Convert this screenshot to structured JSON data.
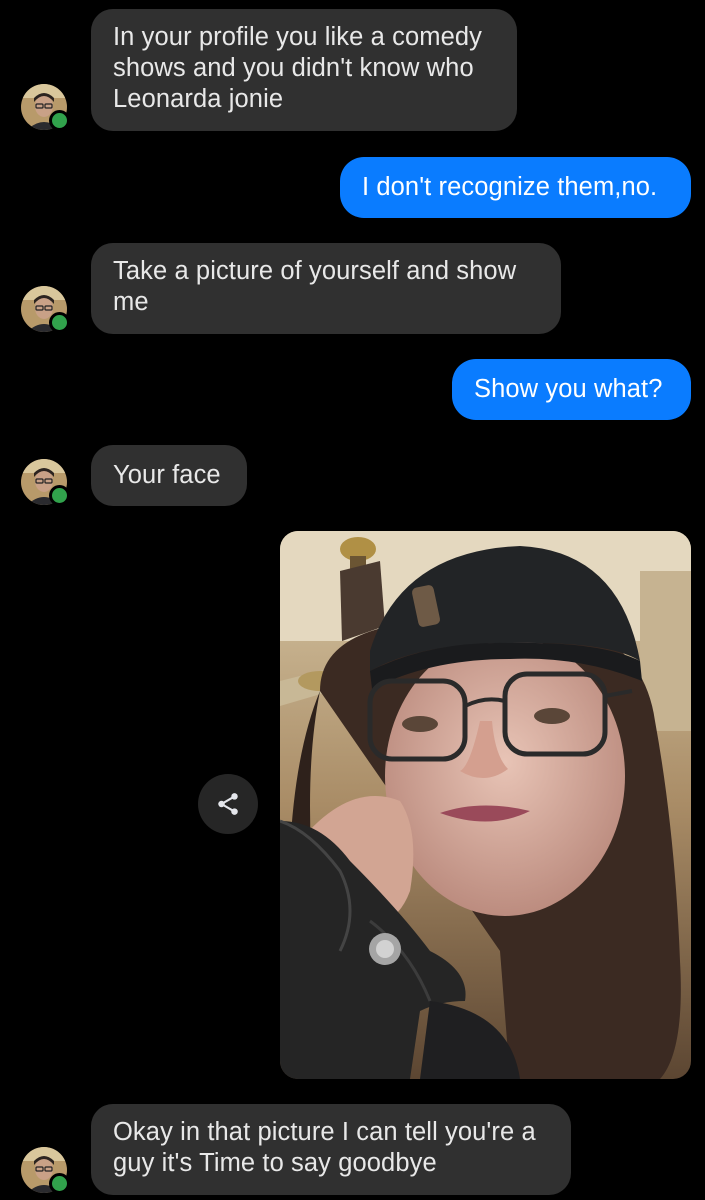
{
  "conversation": {
    "messages": [
      {
        "direction": "incoming",
        "text": "In your profile you like a comedy\nshows and you didn't know who\nLeonarda jonie"
      },
      {
        "direction": "outgoing",
        "text": "I don't recognize them,no."
      },
      {
        "direction": "incoming",
        "text": "Take a picture of yourself and show\nme"
      },
      {
        "direction": "outgoing",
        "text": "Show you what?"
      },
      {
        "direction": "incoming",
        "text": "Your face"
      },
      {
        "direction": "outgoing",
        "type": "photo"
      },
      {
        "direction": "incoming",
        "text": "Okay in that picture I can tell you're a\nguy it's Time to say goodbye"
      }
    ],
    "contact": {
      "online": true
    }
  },
  "icons": {
    "share": "share-icon",
    "presence": "online-status-dot"
  },
  "colors": {
    "background": "#000000",
    "incoming_bubble": "#303030",
    "outgoing_bubble": "#0a7cff",
    "online_status": "#31a24c",
    "share_button": "#262626"
  }
}
